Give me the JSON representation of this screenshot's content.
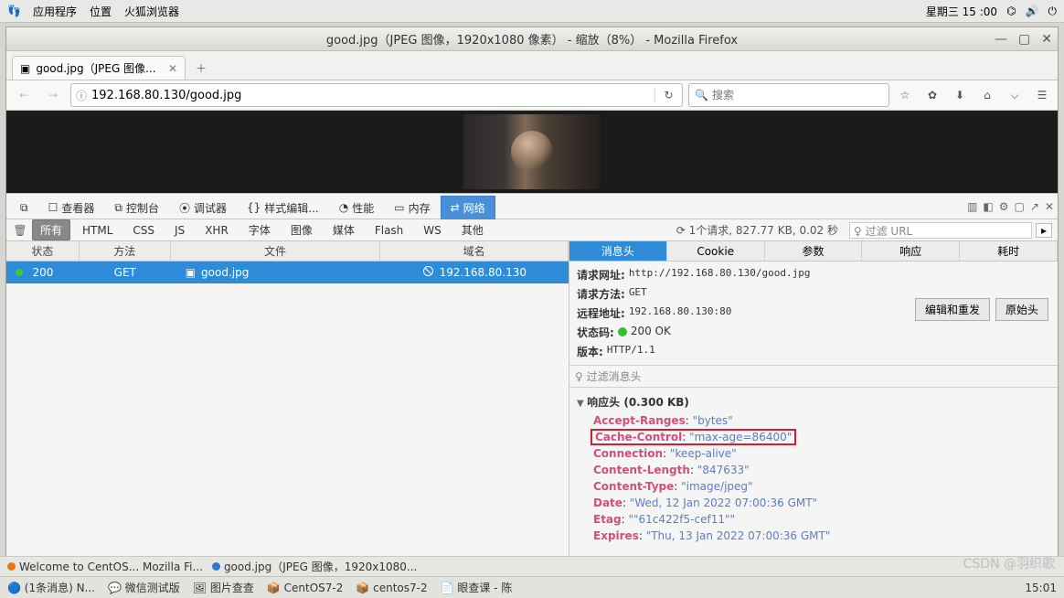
{
  "gnomebar": {
    "apps": "应用程序",
    "places": "位置",
    "ff": "火狐浏览器",
    "clock": "星期三 15 :00"
  },
  "window": {
    "title": "good.jpg（JPEG 图像，1920x1080 像素）  - 缩放（8%） -  Mozilla Firefox"
  },
  "tab": {
    "label": "good.jpg（JPEG 图像..."
  },
  "url": {
    "value": "192.168.80.130/good.jpg",
    "search_ph": "搜索"
  },
  "devtabs": [
    "查看器",
    "控制台",
    "调试器",
    "样式编辑...",
    "性能",
    "内存",
    "网络"
  ],
  "filters": {
    "all": "所有",
    "html": "HTML",
    "css": "CSS",
    "js": "JS",
    "xhr": "XHR",
    "font": "字体",
    "img": "图像",
    "media": "媒体",
    "flash": "Flash",
    "ws": "WS",
    "other": "其他"
  },
  "summary": "1个请求, 827.77 KB, 0.02 秒",
  "filterurl": "过滤 URL",
  "listhead": {
    "state": "状态",
    "method": "方法",
    "file": "文件",
    "domain": "域名"
  },
  "row": {
    "status": "200",
    "method": "GET",
    "file": "good.jpg",
    "domain": "192.168.80.130"
  },
  "dettabs": {
    "headers": "消息头",
    "cookie": "Cookie",
    "params": "参数",
    "resp": "响应",
    "time": "耗时"
  },
  "general": {
    "url_k": "请求网址:",
    "url_v": "http://192.168.80.130/good.jpg",
    "meth_k": "请求方法:",
    "meth_v": "GET",
    "addr_k": "远程地址:",
    "addr_v": "192.168.80.130:80",
    "stat_k": "状态码:",
    "stat_v": "200 OK",
    "ver_k": "版本:",
    "ver_v": "HTTP/1.1"
  },
  "btns": {
    "edit": "编辑和重发",
    "raw": "原始头"
  },
  "filterhead": "过滤消息头",
  "resphead": "响应头 (0.300 KB)",
  "headers": [
    {
      "k": "Accept-Ranges",
      "v": "\"bytes\""
    },
    {
      "k": "Cache-Control",
      "v": "\"max-age=86400\"",
      "boxed": true
    },
    {
      "k": "Connection",
      "v": "\"keep-alive\""
    },
    {
      "k": "Content-Length",
      "v": "\"847633\""
    },
    {
      "k": "Content-Type",
      "v": "\"image/jpeg\""
    },
    {
      "k": "Date",
      "v": "\"Wed, 12 Jan 2022 07:00:36 GMT\""
    },
    {
      "k": "Etag",
      "v": "\"\"61c422f5-cef11\"\""
    },
    {
      "k": "Expires",
      "v": "\"Thu, 13 Jan 2022 07:00:36 GMT\""
    }
  ],
  "taskbar_low": {
    "i1": "Welcome to CentOS...  Mozilla Fi...",
    "i2": "good.jpg（JPEG 图像，1920x1080..."
  },
  "wintask": {
    "a": "(1条消息) N...",
    "b": "微信测试版",
    "c": "图片查查",
    "d": "CentOS7-2",
    "e": "centos7-2",
    "f": "眼查课 - 陈",
    "clock": "15:01"
  },
  "watermark": "CSDN @羽织歌"
}
